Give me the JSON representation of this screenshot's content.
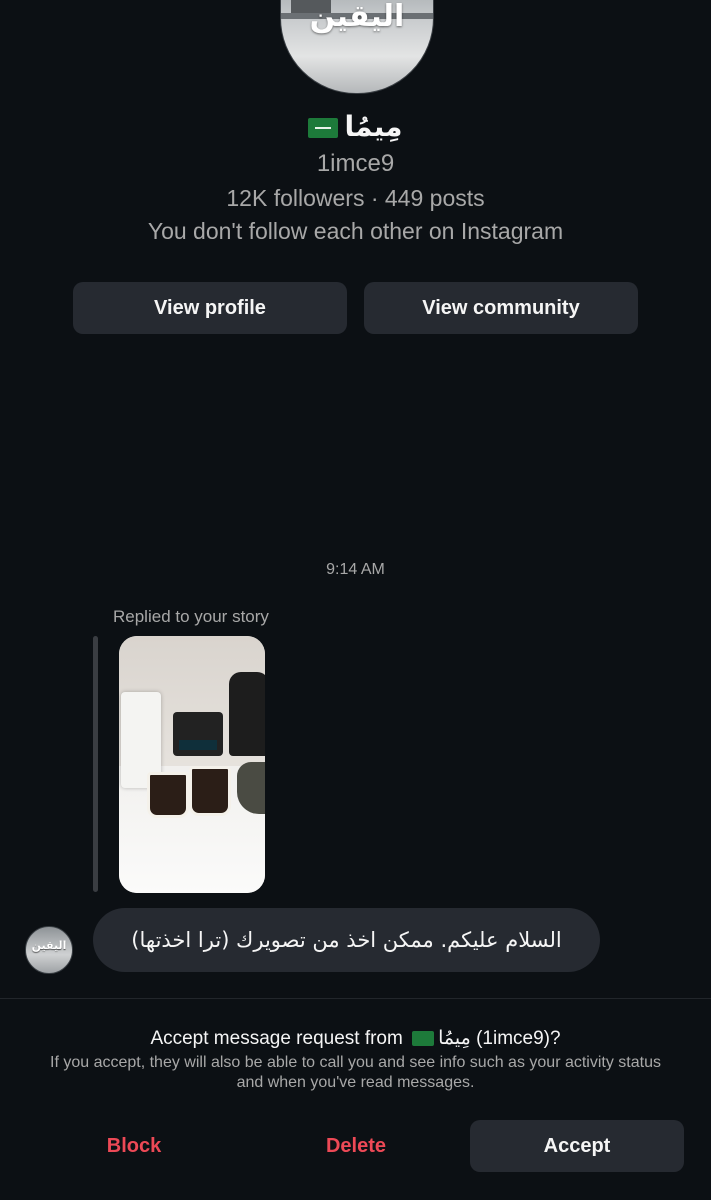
{
  "profile": {
    "avatar_logo_text": "اليقين",
    "display_name": "مِيمُا",
    "flag": "saudi-flag",
    "username": "1imce9",
    "stats": "12K followers · 449 posts",
    "follow_note": "You don't follow each other on Instagram"
  },
  "buttons": {
    "view_profile": "View profile",
    "view_community": "View community"
  },
  "thread": {
    "timestamp": "9:14 AM",
    "replied_label": "Replied to your story",
    "message_text": "السلام عليكم. ممكن اخذ من تصويرك (ترا اخذتها)",
    "sender_avatar_text": "اليقين"
  },
  "request": {
    "title_prefix": "Accept message request from",
    "title_name": "مِيمُا",
    "title_handle": "(1imce9)?",
    "description": "If you accept, they will also be able to call you and see info such as your activity status and when you've read messages."
  },
  "actions": {
    "block": "Block",
    "delete": "Delete",
    "accept": "Accept"
  },
  "colors": {
    "background": "#0c1014",
    "button_bg": "#262a31",
    "danger": "#ed4956",
    "secondary_text": "#a8a8a8"
  }
}
